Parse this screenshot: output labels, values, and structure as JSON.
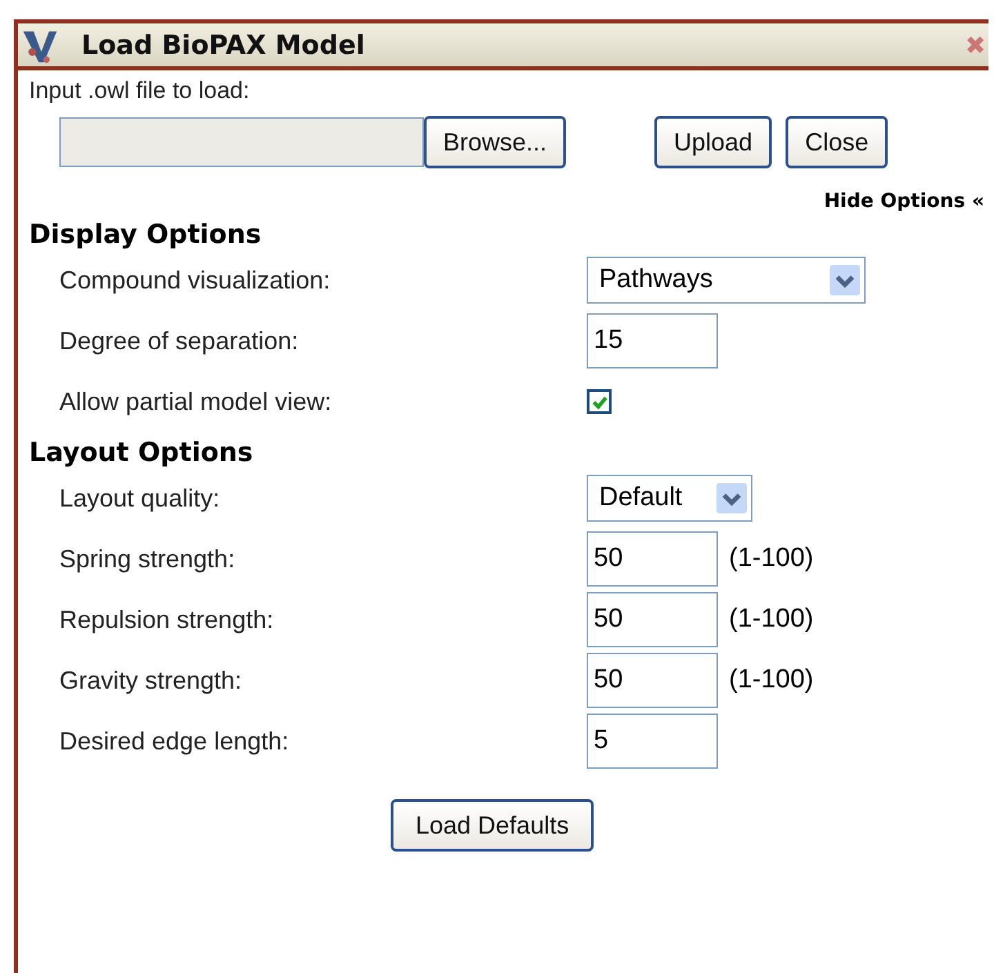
{
  "window": {
    "title": "Load BioPAX Model",
    "close": "✖"
  },
  "file_input": {
    "label": "Input .owl file to load:"
  },
  "buttons": [
    "Browse...",
    "Upload",
    "Close"
  ],
  "toggle_link": "Hide Options «",
  "sections": [
    {
      "title": "Display Options",
      "rows": [
        {
          "kind": "select",
          "label": "Compound visualization:",
          "value": "Pathways",
          "wide": true
        },
        {
          "kind": "text",
          "label": "Degree of separation:",
          "value": "15"
        },
        {
          "kind": "checkbox",
          "label": "Allow partial model view:",
          "checked": true
        }
      ]
    },
    {
      "title": "Layout Options",
      "rows": [
        {
          "kind": "select",
          "label": "Layout quality:",
          "value": "Default",
          "wide": false
        },
        {
          "kind": "text",
          "label": "Spring strength:",
          "value": "50",
          "hint": "(1-100)"
        },
        {
          "kind": "text",
          "label": "Repulsion strength:",
          "value": "50",
          "hint": "(1-100)"
        },
        {
          "kind": "text",
          "label": "Gravity strength:",
          "value": "50",
          "hint": "(1-100)"
        },
        {
          "kind": "text",
          "label": "Desired edge length:",
          "value": "5"
        }
      ]
    }
  ],
  "footer_button": "Load Defaults"
}
